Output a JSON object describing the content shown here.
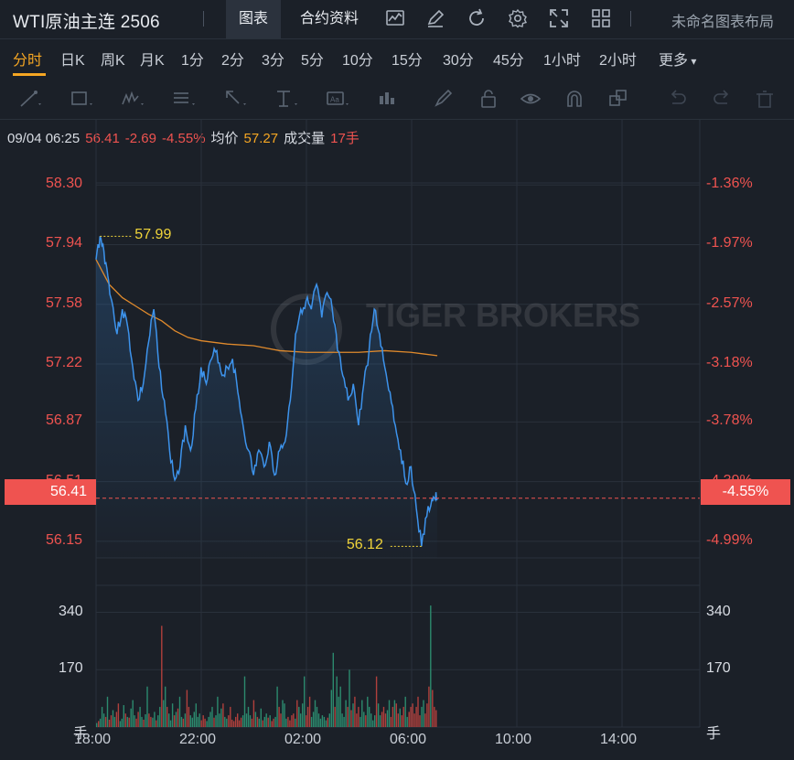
{
  "header": {
    "title": "WTI原油主连 2506",
    "tabs": [
      {
        "label": "图表",
        "active": true
      },
      {
        "label": "合约资料",
        "active": false
      }
    ],
    "tool_icons": [
      "chart-icon",
      "edit-icon",
      "refresh-icon",
      "settings-icon",
      "fullscreen-icon",
      "grid-icon"
    ],
    "layout_label": "未命名图表布局"
  },
  "periods": [
    "分时",
    "日K",
    "周K",
    "月K",
    "1分",
    "2分",
    "3分",
    "5分",
    "10分",
    "15分",
    "30分",
    "45分",
    "1小时",
    "2小时",
    "更多"
  ],
  "active_period": "分时",
  "drawing_tools": [
    "line-tool-icon",
    "rect-tool-icon",
    "wave-tool-icon",
    "fib-tool-icon",
    "arrow-tool-icon",
    "measure-tool-icon",
    "text-tool-icon",
    "candle-tool-icon",
    "brush-icon",
    "lock-icon",
    "eye-icon",
    "magnet-icon",
    "layers-icon",
    "undo-icon",
    "redo-icon",
    "trash-icon"
  ],
  "info": {
    "datetime": "09/04 06:25",
    "price": "56.41",
    "change": "-2.69",
    "change_pct": "-4.55%",
    "avg_label": "均价",
    "avg_value": "57.27",
    "volume_label": "成交量",
    "volume_value": "17手"
  },
  "colors": {
    "up": "#ef5350",
    "down": "#26a69a",
    "price_line": "#3d93ec",
    "avg_line": "#e08a2c",
    "background": "#1b2028",
    "accent": "#f5a623"
  },
  "watermark": "TIGER BROKERS",
  "chart_data": {
    "type": "line",
    "price_axis_left": [
      "58.30",
      "57.94",
      "57.58",
      "57.22",
      "56.87",
      "56.51",
      "56.15"
    ],
    "price_axis_right": [
      "-1.36%",
      "-1.97%",
      "-2.57%",
      "-3.18%",
      "-3.78%",
      "-4.39%",
      "-4.99%"
    ],
    "volume_axis": [
      "340",
      "170"
    ],
    "volume_unit": "手",
    "x_ticks": [
      "18:00",
      "22:00",
      "02:00",
      "06:00",
      "10:00",
      "14:00"
    ],
    "current_price": "56.41",
    "current_pct": "-4.55%",
    "high_label": "57.99",
    "low_label": "56.12",
    "ylim": [
      56.05,
      58.45
    ],
    "xlim_hours": [
      0,
      23
    ],
    "series": [
      {
        "type": "price",
        "x_hours": [
          0,
          0.15,
          0.3,
          0.45,
          0.6,
          0.8,
          1.0,
          1.2,
          1.4,
          1.6,
          1.8,
          2.0,
          2.2,
          2.4,
          2.6,
          2.8,
          3.0,
          3.2,
          3.4,
          3.6,
          3.8,
          4.0,
          4.2,
          4.4,
          4.6,
          4.8,
          5.0,
          5.2,
          5.4,
          5.6,
          5.8,
          6.0,
          6.2,
          6.4,
          6.6,
          6.8,
          7.0,
          7.2,
          7.4,
          7.6,
          7.8,
          8.0,
          8.2,
          8.4,
          8.6,
          8.8,
          9.0,
          9.2,
          9.4,
          9.6,
          9.8,
          10.0,
          10.2,
          10.4,
          10.6,
          10.8,
          11.0,
          11.2,
          11.4,
          11.6,
          11.8,
          12.0,
          12.2,
          12.4,
          12.6,
          12.8,
          12.9,
          13.0
        ],
        "values": [
          57.85,
          57.99,
          57.9,
          57.75,
          57.6,
          57.4,
          57.55,
          57.45,
          57.2,
          57.0,
          57.1,
          57.35,
          57.55,
          57.2,
          57.0,
          56.7,
          56.52,
          56.6,
          56.85,
          56.7,
          56.95,
          57.2,
          57.1,
          57.25,
          57.3,
          57.15,
          57.2,
          57.25,
          57.05,
          56.85,
          56.7,
          56.55,
          56.7,
          56.6,
          56.75,
          56.55,
          56.7,
          56.75,
          57.0,
          57.4,
          57.55,
          57.6,
          57.55,
          57.7,
          57.5,
          57.65,
          57.55,
          57.3,
          57.15,
          57.0,
          57.1,
          56.85,
          57.1,
          57.3,
          57.55,
          57.4,
          57.2,
          57.05,
          56.85,
          56.7,
          56.5,
          56.6,
          56.35,
          56.12,
          56.3,
          56.41,
          56.41,
          56.41
        ]
      },
      {
        "type": "average",
        "x_hours": [
          0,
          0.5,
          1.0,
          1.5,
          2.0,
          2.5,
          3.0,
          3.5,
          4.0,
          5.0,
          6.0,
          7.0,
          8.0,
          9.0,
          10.0,
          11.0,
          12.0,
          12.5,
          13.0
        ],
        "values": [
          57.85,
          57.7,
          57.62,
          57.57,
          57.52,
          57.48,
          57.42,
          57.38,
          57.36,
          57.34,
          57.33,
          57.3,
          57.29,
          57.29,
          57.29,
          57.3,
          57.29,
          57.28,
          57.27
        ]
      },
      {
        "type": "volume",
        "values": [
          12,
          18,
          25,
          60,
          40,
          30,
          90,
          22,
          35,
          50,
          30,
          45,
          70,
          18,
          25,
          65,
          40,
          30,
          28,
          55,
          80,
          35,
          25,
          45,
          60,
          30,
          22,
          38,
          120,
          40,
          30,
          28,
          45,
          20,
          35,
          60,
          300,
          80,
          120,
          60,
          40,
          20,
          70,
          35,
          45,
          55,
          90,
          30,
          25,
          40,
          110,
          60,
          35,
          28,
          45,
          70,
          30,
          40,
          20,
          35,
          25,
          18,
          30,
          45,
          60,
          28,
          35,
          90,
          40,
          55,
          70,
          30,
          25,
          35,
          60,
          22,
          18,
          30,
          40,
          20,
          28,
          35,
          150,
          40,
          60,
          35,
          25,
          80,
          45,
          30,
          25,
          55,
          20,
          30,
          40,
          28,
          35,
          18,
          25,
          30,
          120,
          60,
          40,
          80,
          70,
          25,
          30,
          20,
          35,
          40,
          25,
          80,
          60,
          40,
          70,
          150,
          35,
          60,
          90,
          30,
          45,
          80,
          60,
          40,
          25,
          35,
          30,
          20,
          28,
          40,
          110,
          220,
          60,
          150,
          90,
          120,
          40,
          30,
          80,
          60,
          170,
          50,
          70,
          90,
          40,
          60,
          30,
          80,
          45,
          35,
          90,
          60,
          40,
          20,
          35,
          150,
          70,
          35,
          45,
          60,
          40,
          50,
          80,
          30,
          60,
          80,
          70,
          40,
          55,
          35,
          60,
          90,
          30,
          45,
          60,
          70,
          40,
          60,
          90,
          35,
          60,
          80,
          40,
          70,
          120,
          360,
          110,
          60,
          50
        ],
        "up_flags_seed": 7
      }
    ]
  }
}
